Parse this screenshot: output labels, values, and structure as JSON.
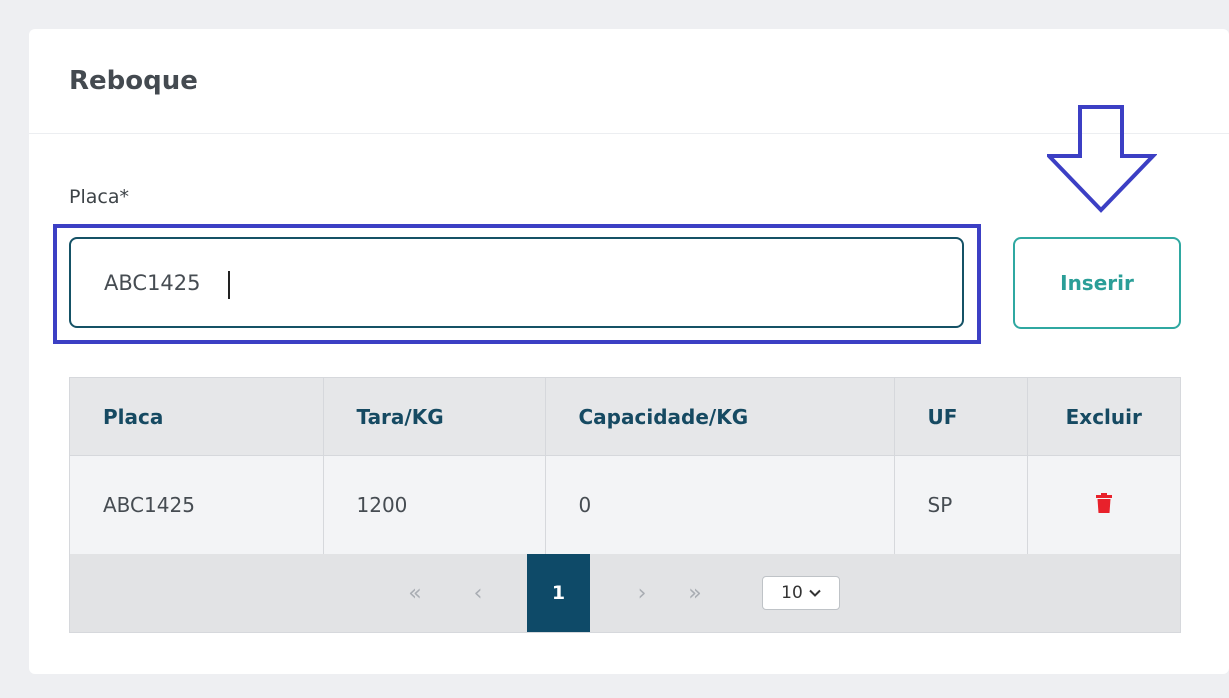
{
  "section": {
    "title": "Reboque"
  },
  "form": {
    "label": "Placa*",
    "input_value": "ABC1425",
    "insert_label": "Inserir"
  },
  "table": {
    "columns": [
      "Placa",
      "Tara/KG",
      "Capacidade/KG",
      "UF",
      "Excluir"
    ],
    "rows": [
      {
        "placa": "ABC1425",
        "tara": "1200",
        "capacidade": "0",
        "uf": "SP",
        "delete_icon": "trash-icon"
      }
    ]
  },
  "pagination": {
    "first": "«",
    "prev": "‹",
    "current_page": "1",
    "next": "›",
    "last": "»",
    "page_size": "10"
  },
  "colors": {
    "accent_teal": "#2fa8a1",
    "header_text": "#164a62",
    "active_page": "#0e4a68",
    "annotation": "#3c3fc4",
    "delete": "#e8212b"
  }
}
